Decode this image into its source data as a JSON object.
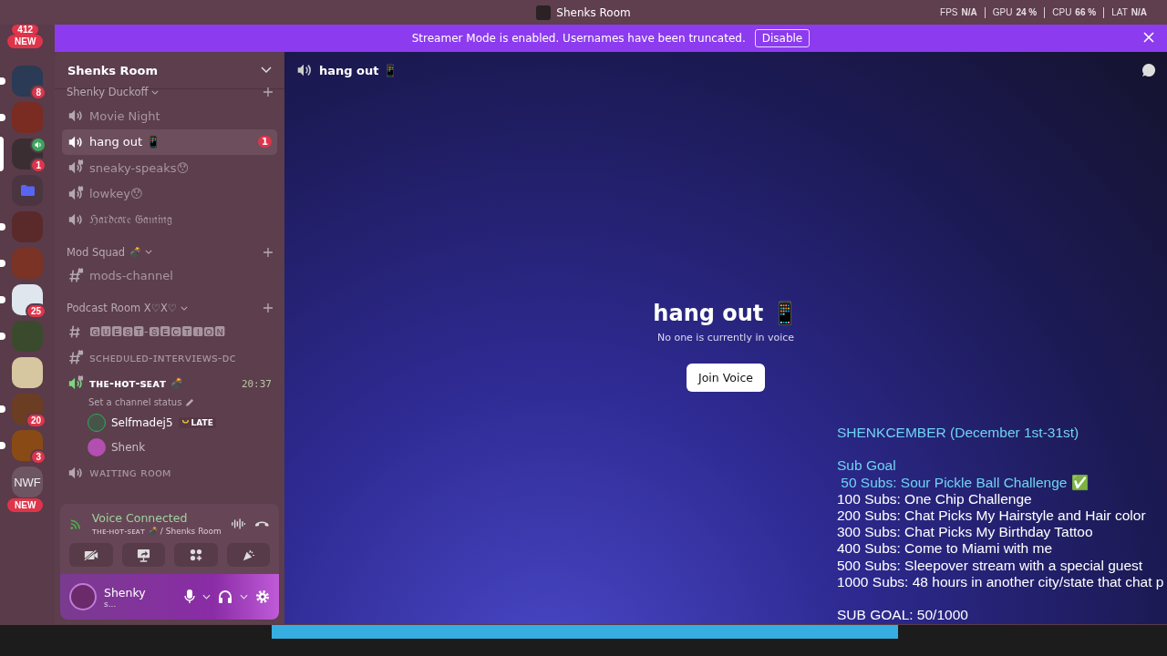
{
  "window": {
    "title": "Shenks Room"
  },
  "stats": [
    {
      "label": "FPS",
      "value": "N/A"
    },
    {
      "label": "GPU",
      "value": "24 %"
    },
    {
      "label": "CPU",
      "value": "66 %"
    },
    {
      "label": "LAT",
      "value": "N/A"
    }
  ],
  "banner": {
    "text": "Streamer Mode is enabled. Usernames have been truncated.",
    "button": "Disable"
  },
  "servers": {
    "top_badges": [
      "412",
      "NEW"
    ],
    "items": [
      {
        "kind": "image",
        "badge": "8",
        "unread": true,
        "selected": false,
        "voice": false
      },
      {
        "kind": "image",
        "unread": true,
        "selected": false,
        "voice": false
      },
      {
        "kind": "image",
        "badge": "1",
        "unread": false,
        "selected": true,
        "voice": true
      },
      {
        "kind": "folder",
        "unread": false,
        "selected": false,
        "voice": false
      },
      {
        "kind": "image",
        "unread": true,
        "selected": false,
        "voice": false
      },
      {
        "kind": "image",
        "unread": true,
        "selected": false,
        "voice": false
      },
      {
        "kind": "image",
        "badge": "25",
        "unread": true,
        "selected": false,
        "voice": false
      },
      {
        "kind": "image",
        "unread": true,
        "selected": false,
        "voice": false
      },
      {
        "kind": "image",
        "unread": false,
        "selected": false,
        "voice": false
      },
      {
        "kind": "image",
        "badge": "20",
        "unread": true,
        "selected": false,
        "voice": false
      },
      {
        "kind": "image",
        "badge": "3",
        "unread": true,
        "selected": false,
        "voice": false
      },
      {
        "kind": "text",
        "label": "NWF",
        "unread": false,
        "selected": false,
        "voice": false
      }
    ],
    "bottom_badge": "NEW"
  },
  "sidebar": {
    "server_name": "Shenks Room",
    "categories": [
      {
        "name": "Shenky Duckoff",
        "channels": [
          {
            "kind": "voice",
            "name": "Movie Night",
            "locked": false,
            "selected": false
          },
          {
            "kind": "voice",
            "name": "hang out 📱",
            "locked": false,
            "selected": true,
            "badge": "1"
          },
          {
            "kind": "voice",
            "name": "sneaky-speaks😯",
            "locked": true,
            "selected": false
          },
          {
            "kind": "voice",
            "name": "lowkey😯",
            "locked": true,
            "selected": false
          },
          {
            "kind": "voice",
            "name": "ℌ𝔞𝔯𝔡𝔠𝔬𝔯𝔢 𝔊𝔞𝔪𝔦𝔫𝔤",
            "locked": false,
            "selected": false
          }
        ]
      },
      {
        "name": "Mod Squad 💣",
        "channels": [
          {
            "kind": "text",
            "name": "mods-channel",
            "locked": true,
            "selected": false
          }
        ]
      },
      {
        "name": "Podcast Room X♡X♡",
        "channels": [
          {
            "kind": "text",
            "name": "🅶🆄🅴🆂🆃-🆂🅴🅲🆃🅸🅾🅽",
            "locked": false,
            "selected": false
          },
          {
            "kind": "text",
            "name": "ꜱᴄʜᴇᴅᴜʟᴇᴅ-ɪɴᴛᴇʀᴠɪᴇᴡꜱ-ᴅᴄ",
            "locked": true,
            "selected": false
          },
          {
            "kind": "live",
            "name": "ᴛʜᴇ-ʜᴏᴛ-ꜱᴇᴀᴛ 💣",
            "locked": true,
            "selected": false,
            "time": "20:37",
            "status": "Set a channel status",
            "members": [
              {
                "name": "Selfmadej5",
                "tag": "LATE"
              },
              {
                "name": "Shenk"
              }
            ]
          },
          {
            "kind": "voice",
            "name": "ᴡᴀɪᴛɪɴɢ ʀᴏᴏᴍ",
            "locked": false,
            "selected": false
          }
        ]
      }
    ]
  },
  "voice_panel": {
    "title": "Voice Connected",
    "location": "ᴛʜᴇ-ʜᴏᴛ-ꜱᴇᴀᴛ 💣 / Shenks Room"
  },
  "user_panel": {
    "name": "Shenky",
    "status": "s..."
  },
  "main": {
    "channel": "hang out 📱",
    "title": "hang out 📱",
    "subtitle": "No one is currently in voice",
    "button": "Join Voice"
  },
  "overlay": {
    "title": "SHENKCEMBER (December 1st-31st)",
    "heading": "Sub Goal",
    "goals": [
      {
        "text": " 50 Subs: Sour Pickle Ball Challenge ✅",
        "color": "#6fd3f2"
      },
      {
        "text": "100 Subs: One Chip Challenge",
        "color": "#ffffff"
      },
      {
        "text": "200 Subs: Chat Picks My Hairstyle and Hair color",
        "color": "#ffffff"
      },
      {
        "text": "300 Subs: Chat Picks My Birthday Tattoo",
        "color": "#ffffff"
      },
      {
        "text": "400 Subs: Come to Miami with me",
        "color": "#ffffff"
      },
      {
        "text": "500 Subs: Sleepover stream with a special guest",
        "color": "#ffffff"
      },
      {
        "text": "1000 Subs: 48 hours in another city/state that chat p",
        "color": "#ffffff"
      }
    ],
    "total": "SUB GOAL: 50/1000"
  },
  "stream_bar": {
    "level": 0.7
  }
}
